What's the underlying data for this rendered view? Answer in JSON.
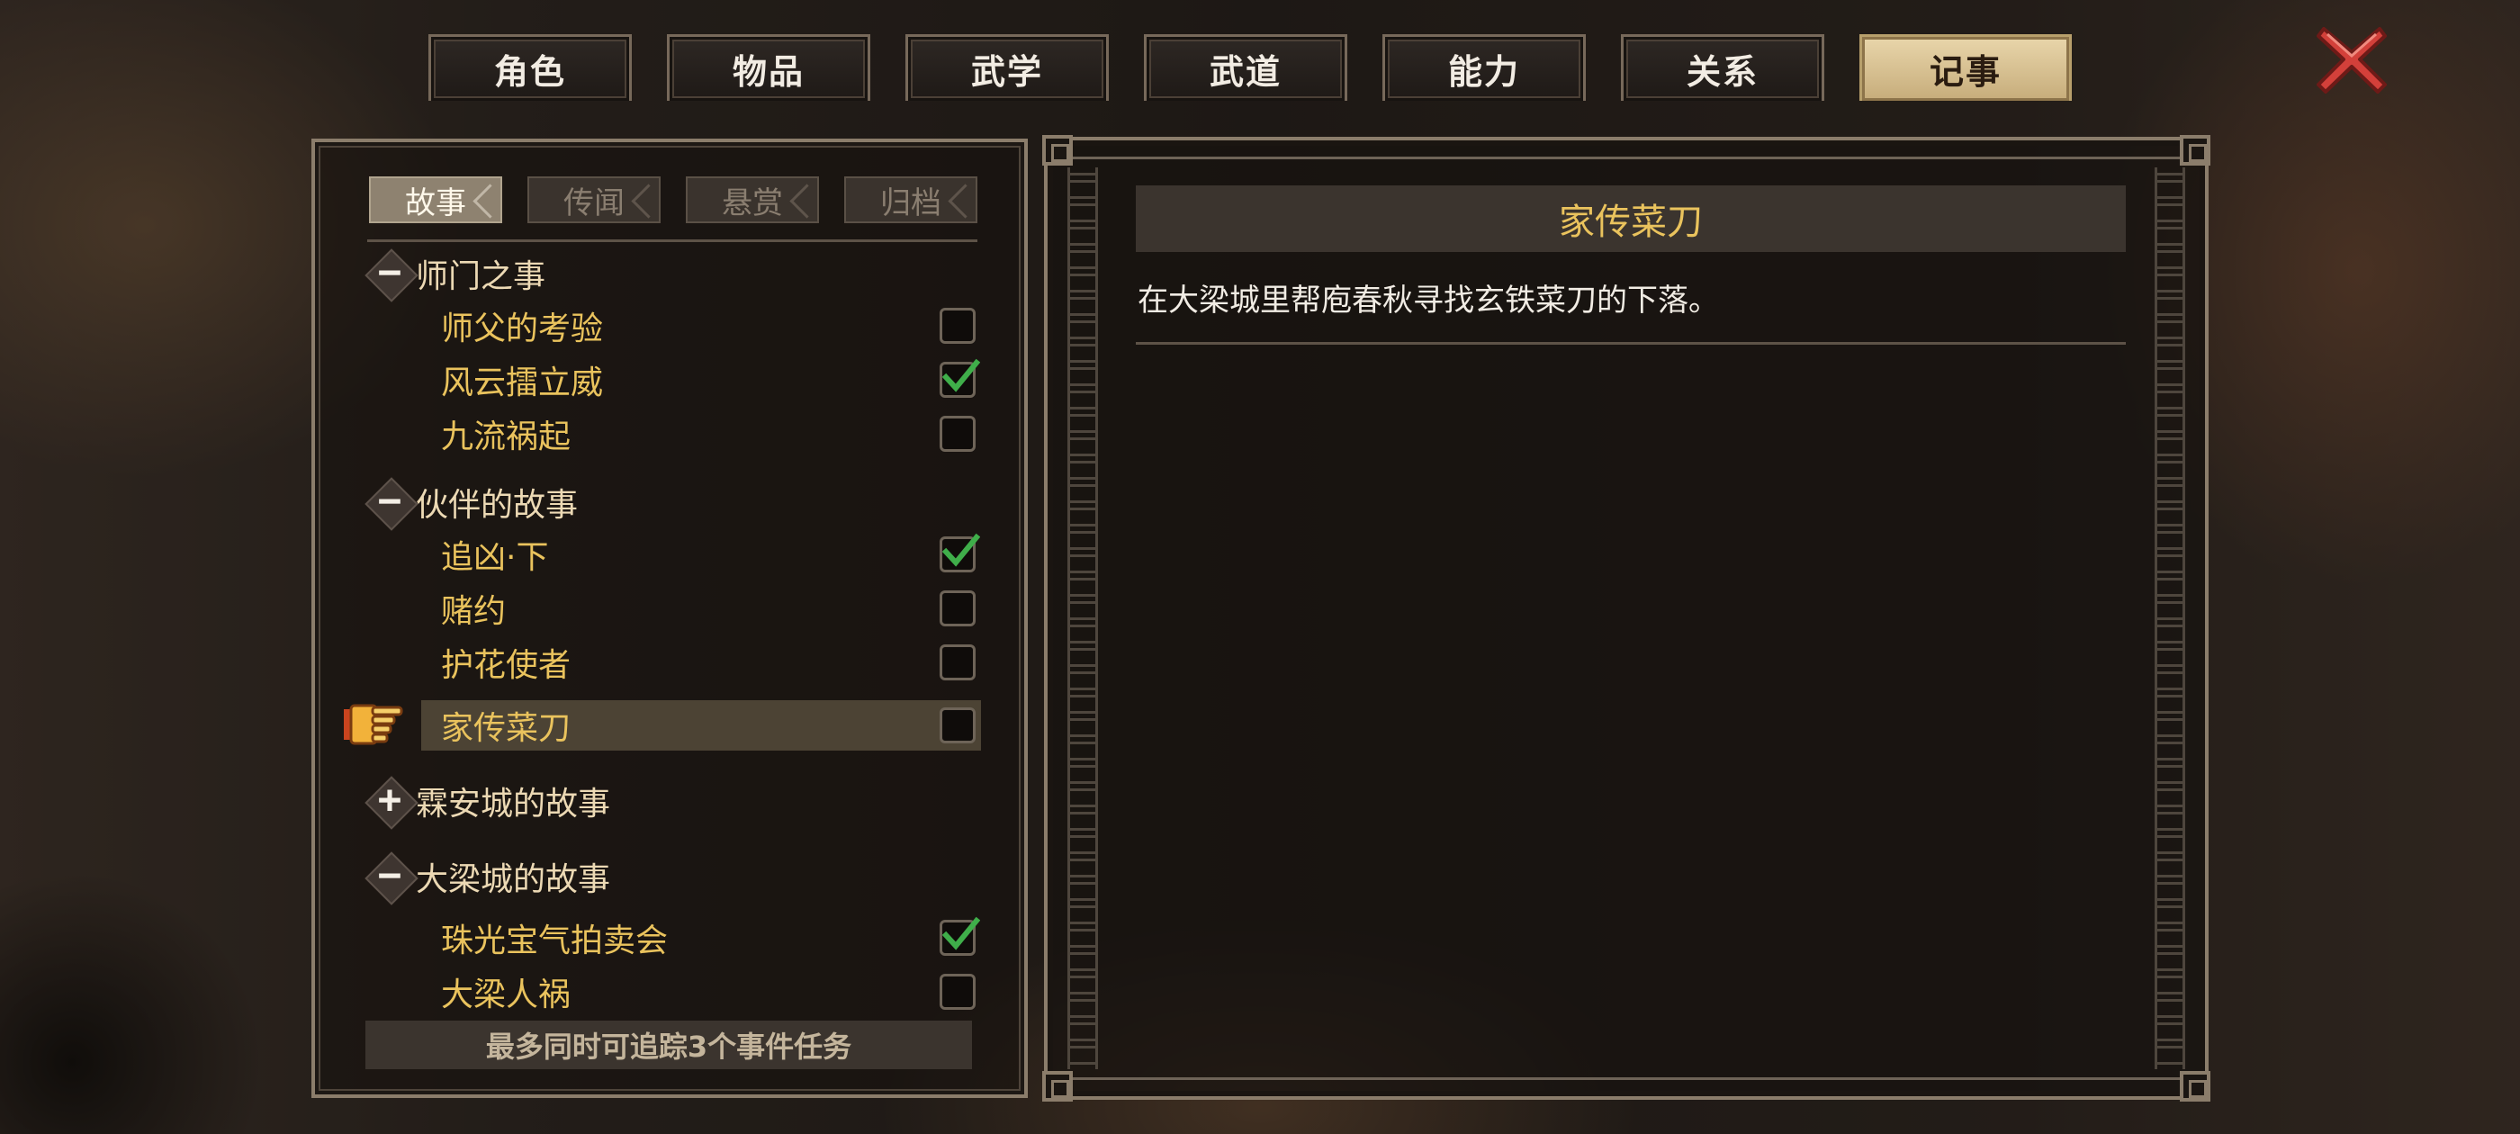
{
  "tabs": [
    {
      "label": "角色",
      "active": false
    },
    {
      "label": "物品",
      "active": false
    },
    {
      "label": "武学",
      "active": false
    },
    {
      "label": "武道",
      "active": false
    },
    {
      "label": "能力",
      "active": false
    },
    {
      "label": "关系",
      "active": false
    },
    {
      "label": "记事",
      "active": true
    }
  ],
  "close_icon": "close-x-icon",
  "subtabs": [
    {
      "label": "故事",
      "active": true
    },
    {
      "label": "传闻",
      "active": false
    },
    {
      "label": "悬赏",
      "active": false
    },
    {
      "label": "归档",
      "active": false
    }
  ],
  "groups": [
    {
      "title": "师门之事",
      "expanded": true,
      "quests": [
        {
          "name": "师父的考验",
          "done": false
        },
        {
          "name": "风云擂立威",
          "done": true
        },
        {
          "name": "九流祸起",
          "done": false
        }
      ]
    },
    {
      "title": "伙伴的故事",
      "expanded": true,
      "quests": [
        {
          "name": "追凶·下",
          "done": true
        },
        {
          "name": "赌约",
          "done": false
        },
        {
          "name": "护花使者",
          "done": false
        },
        {
          "name": "家传菜刀",
          "done": false,
          "selected": true
        }
      ]
    },
    {
      "title": "霖安城的故事",
      "expanded": false,
      "quests": []
    },
    {
      "title": "大梁城的故事",
      "expanded": true,
      "quests": [
        {
          "name": "珠光宝气拍卖会",
          "done": true
        },
        {
          "name": "大梁人祸",
          "done": false
        }
      ]
    }
  ],
  "footer": "最多同时可追踪3个事件任务",
  "detail": {
    "title": "家传菜刀",
    "description": "在大梁城里帮庖春秋寻找玄铁菜刀的下落。"
  },
  "colors": {
    "accent_gold": "#eac35d",
    "active_tab": "#dcc597",
    "check_green": "#3fae4a",
    "close_red": "#d3403a"
  }
}
